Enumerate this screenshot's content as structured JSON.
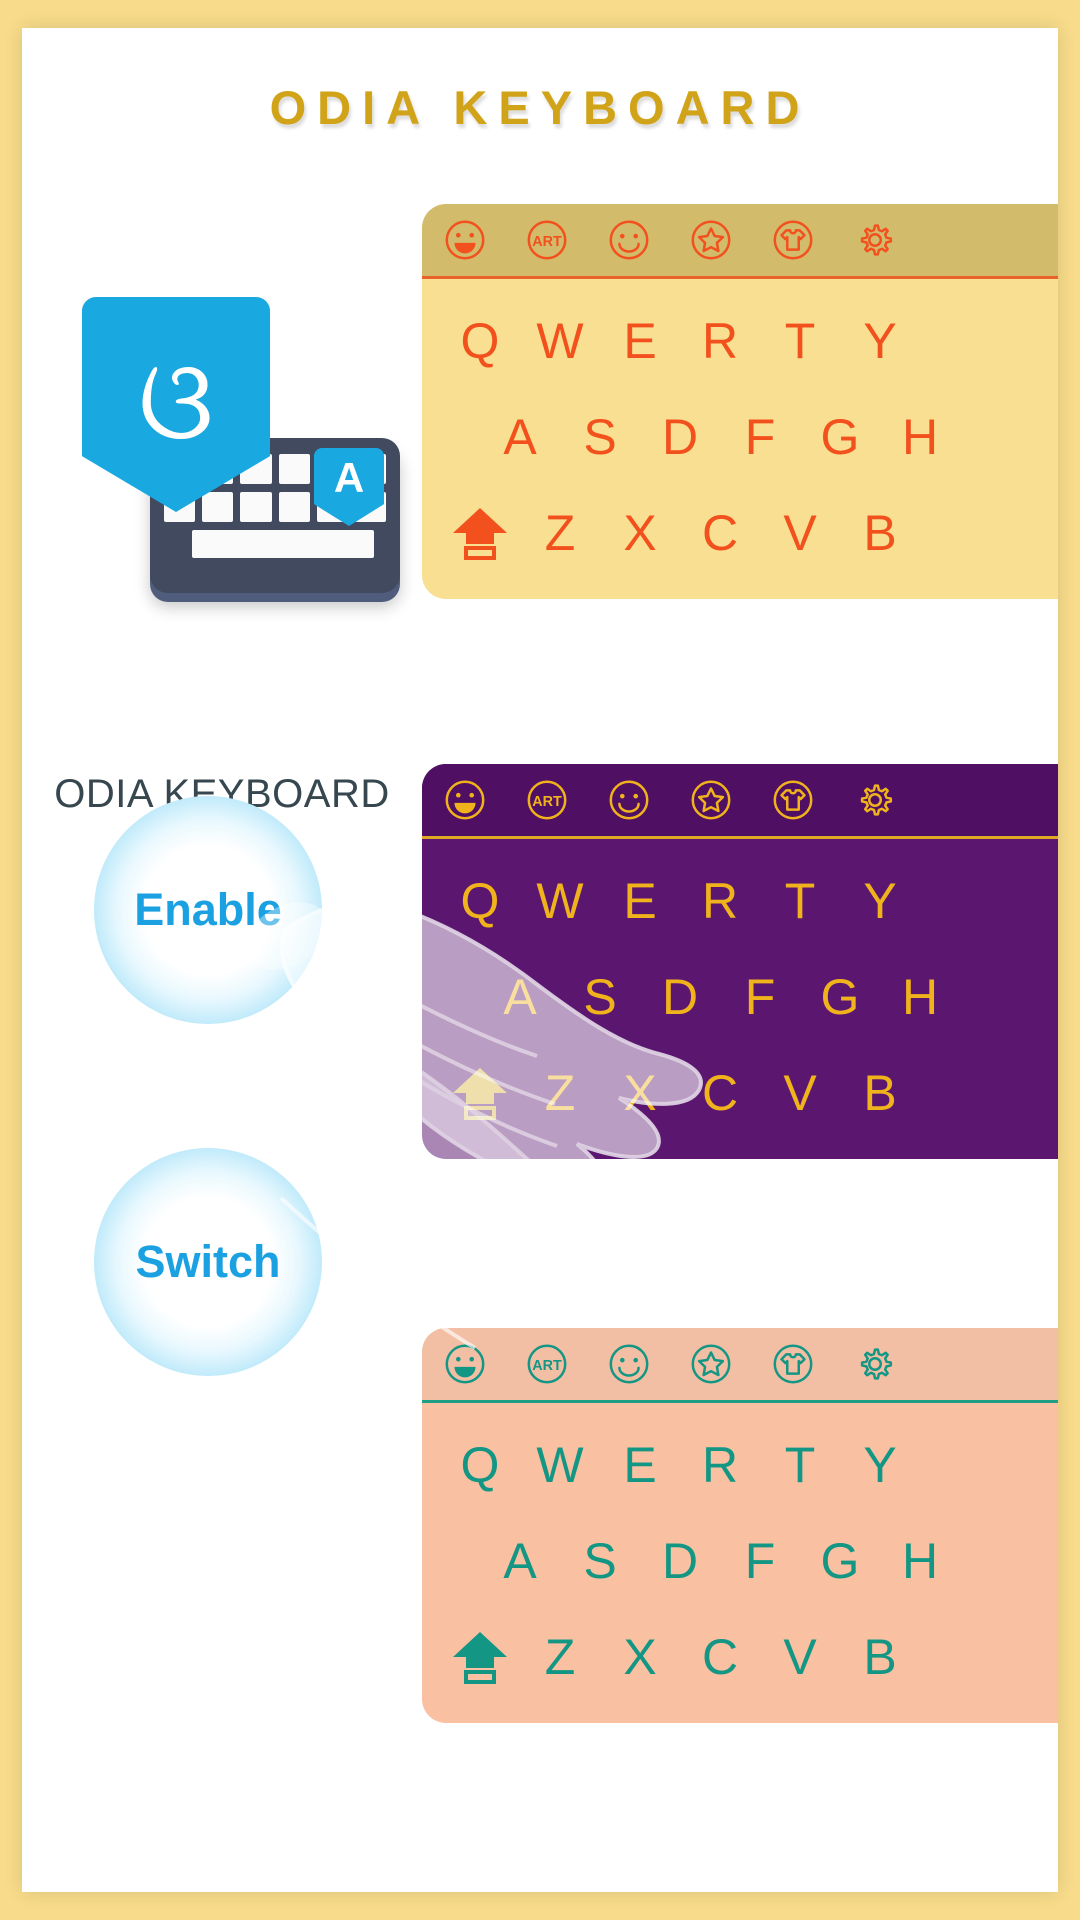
{
  "page": {
    "title": "ODIA KEYBOARD",
    "background_color": "#F8DC8B",
    "card_color": "#FFFFFF",
    "title_color": "#D1A319"
  },
  "app": {
    "icon_glyph": "ଓ",
    "icon_badge_letter": "A",
    "icon_color": "#19A8E0",
    "keyboard_color": "#414A5E",
    "caption": "ODIA KEYBOARD",
    "caption_color": "#37474F"
  },
  "buttons": [
    {
      "name": "enable",
      "label": "Enable",
      "text_color": "#1BA1E2"
    },
    {
      "name": "switch",
      "label": "Switch",
      "text_color": "#1BA1E2"
    }
  ],
  "toolbar_icons": [
    "grin-emoji-icon",
    "art-icon",
    "smiley-emoji-icon",
    "star-icon",
    "tshirt-icon",
    "gear-icon"
  ],
  "keyboard_rows": {
    "row1": [
      "Q",
      "W",
      "E",
      "R",
      "T",
      "Y"
    ],
    "row2": [
      "A",
      "S",
      "D",
      "F",
      "G",
      "H"
    ],
    "row3": [
      "Z",
      "X",
      "C",
      "V",
      "B"
    ],
    "shift_key": "shift-arrow-icon"
  },
  "themes": [
    {
      "name": "yellow-theme",
      "background": "#F9DF91",
      "toolbar": "#D3BB6C",
      "accent": "#F2511E",
      "divider": "#E8622A"
    },
    {
      "name": "purple-theme",
      "background": "#5B1770",
      "toolbar": "#4F0F63",
      "accent": "#F0B31C",
      "divider": "#E0A923"
    },
    {
      "name": "peach-theme",
      "background": "#F9C1A2",
      "toolbar": "#F2BFA5",
      "accent": "#149684",
      "divider": "#1E9E84"
    }
  ],
  "overlay": {
    "hand_illustration": "hand-pointing-icon"
  }
}
